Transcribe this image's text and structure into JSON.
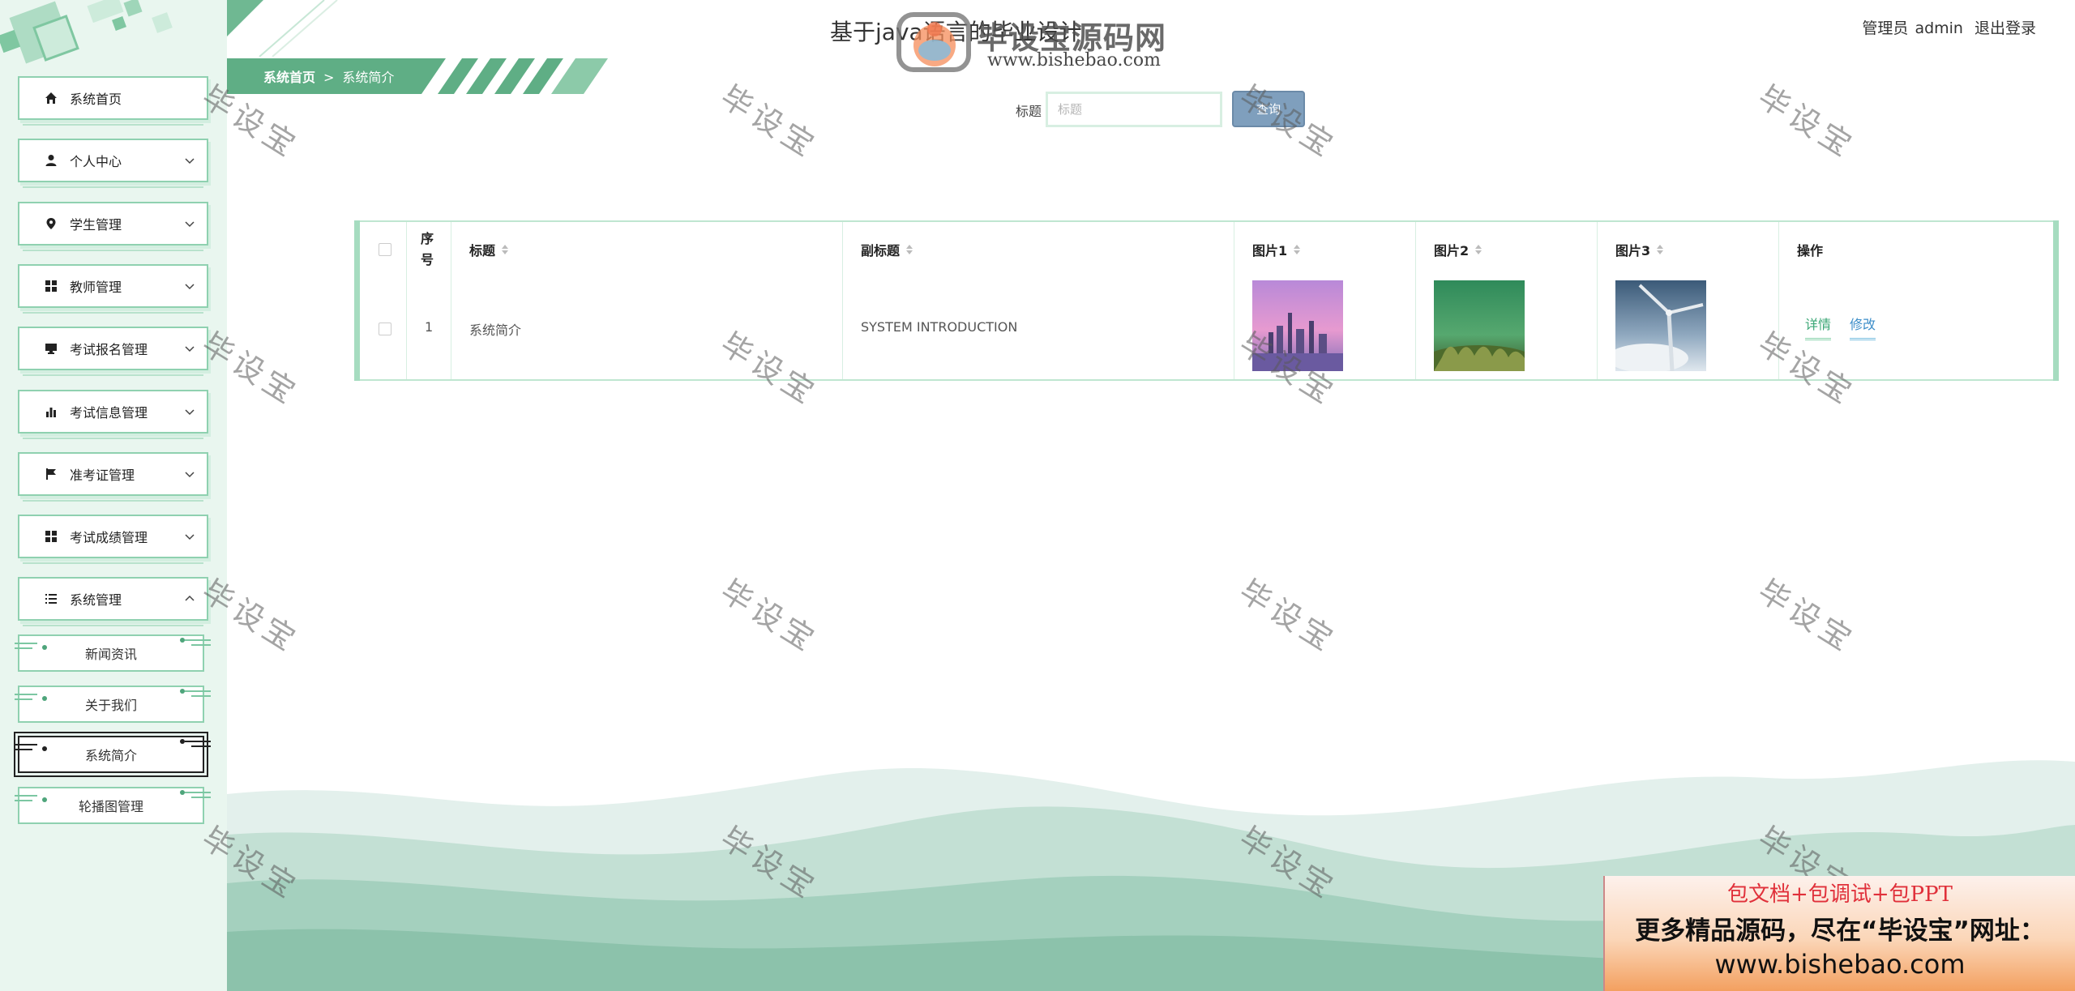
{
  "header": {
    "title": "基于java语言的毕业设计",
    "user_role": "管理员",
    "username": "admin",
    "logout": "退出登录"
  },
  "watermark_logo": {
    "name": "毕设宝源码网",
    "url": "www.bishebao.com",
    "tile_text": "毕设宝"
  },
  "breadcrumb": {
    "home": "系统首页",
    "separator": ">",
    "current": "系统简介"
  },
  "sidebar": {
    "items": [
      {
        "label": "系统首页",
        "icon": "home-icon"
      },
      {
        "label": "个人中心",
        "icon": "user-icon",
        "expandable": true
      },
      {
        "label": "学生管理",
        "icon": "location-pin-icon",
        "expandable": true
      },
      {
        "label": "教师管理",
        "icon": "grid-icon",
        "expandable": true
      },
      {
        "label": "考试报名管理",
        "icon": "monitor-icon",
        "expandable": true
      },
      {
        "label": "考试信息管理",
        "icon": "bar-chart-icon",
        "expandable": true
      },
      {
        "label": "准考证管理",
        "icon": "flag-icon",
        "expandable": true
      },
      {
        "label": "考试成绩管理",
        "icon": "grid-icon",
        "expandable": true
      },
      {
        "label": "系统管理",
        "icon": "list-icon",
        "expandable": true,
        "expanded": true
      }
    ],
    "sub_items": [
      {
        "label": "新闻资讯"
      },
      {
        "label": "关于我们"
      },
      {
        "label": "系统简介",
        "active": true
      },
      {
        "label": "轮播图管理"
      }
    ]
  },
  "search": {
    "label": "标题",
    "placeholder": "标题",
    "button": "查询"
  },
  "table": {
    "headers": {
      "index": "序号",
      "title": "标题",
      "subtitle": "副标题",
      "image1": "图片1",
      "image2": "图片2",
      "image3": "图片3",
      "actions": "操作"
    },
    "rows": [
      {
        "index": "1",
        "title": "系统简介",
        "subtitle": "SYSTEM INTRODUCTION",
        "image1": "city-skyline-purple",
        "image2": "green-grass-macro",
        "image3": "wind-turbine-sky",
        "detail": "详情",
        "edit": "修改"
      }
    ]
  },
  "promo": {
    "line1": "包文档+包调试+包PPT",
    "line2": "更多精品源码，尽在“毕设宝”网址：",
    "url": "www.bishebao.com"
  },
  "colors": {
    "sidebar_bg": "#e9f6ef",
    "accent_green": "#5fae85",
    "border_green": "#8fd1b0",
    "search_button": "#7f9fbd",
    "edit_link": "#3d8ec9",
    "detail_link": "#3ba776"
  }
}
